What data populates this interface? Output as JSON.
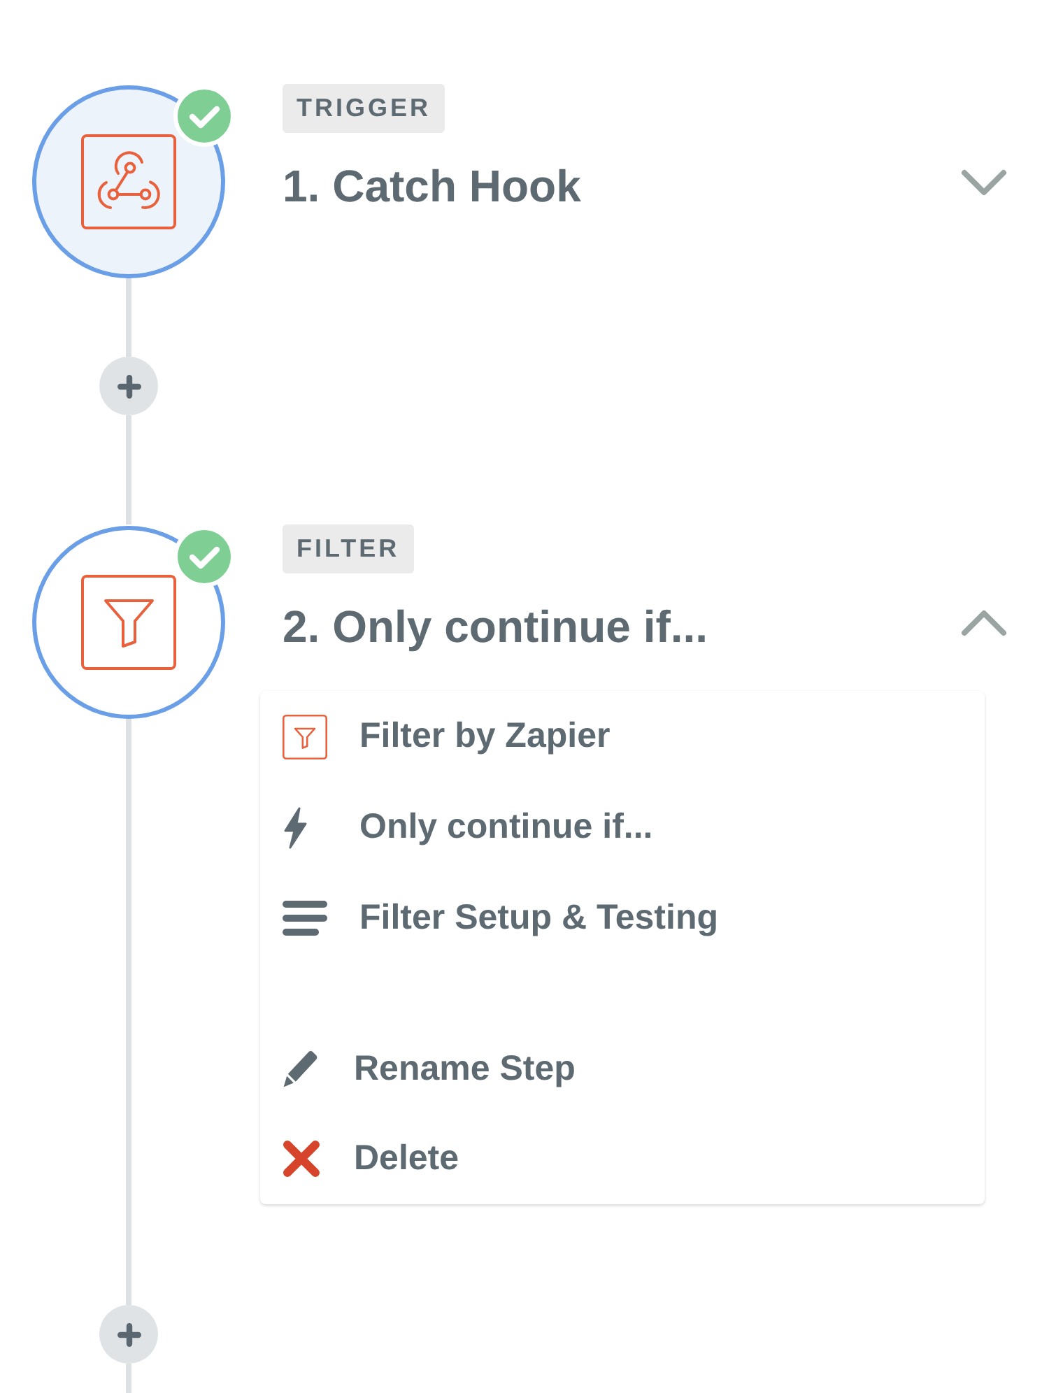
{
  "steps": [
    {
      "kind": "trigger",
      "tag": "TRIGGER",
      "title": "1. Catch Hook",
      "highlighted": true,
      "complete": true,
      "expanded": false
    },
    {
      "kind": "filter",
      "tag": "FILTER",
      "title": "2. Only continue if...",
      "highlighted": false,
      "complete": true,
      "expanded": true,
      "menu": {
        "items": [
          {
            "kind": "app",
            "label": "Filter by Zapier"
          },
          {
            "kind": "event",
            "label": "Only continue if..."
          },
          {
            "kind": "setup",
            "label": "Filter Setup & Testing"
          }
        ],
        "actions": [
          {
            "kind": "rename",
            "label": "Rename Step"
          },
          {
            "kind": "delete",
            "label": "Delete"
          }
        ]
      }
    }
  ]
}
